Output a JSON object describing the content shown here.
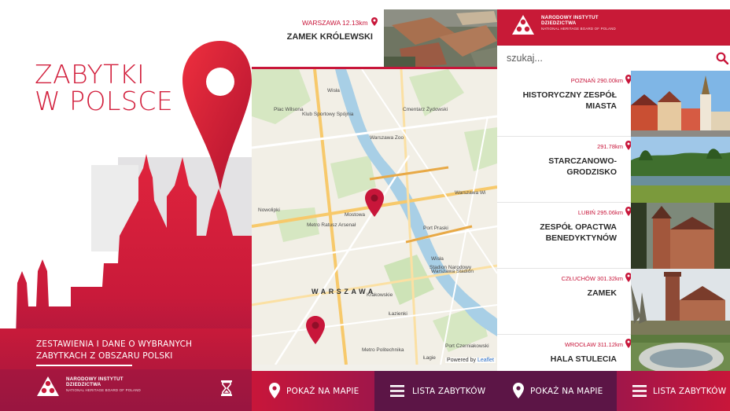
{
  "splash": {
    "title_line1": "ZABYTKI",
    "title_line2": "W POLSCE",
    "subtitle_line1": "ZESTAWIENIA I DANE O WYBRANYCH",
    "subtitle_line2": "ZABYTKACH Z OBSZARU POLSKI",
    "logo_line1": "NARODOWY INSTYTUT",
    "logo_line2": "DZIEDZICTWA",
    "logo_line3": "NATIONAL HERITAGE BOARD OF POLAND",
    "loading_icon": "hourglass-icon"
  },
  "map_screen": {
    "selected": {
      "distance": "WARSZAWA 12.13km",
      "name": "ZAMEK KRÓLEWSKI"
    },
    "city_label": "WARSZAWA",
    "attribution_prefix": "Powered by",
    "attribution_link": "Leaflet",
    "labels": [
      "Wisła",
      "Plac Wilsona",
      "Klub Sportowy Spójnia",
      "Cmentarz Żydowski",
      "Warszawa Zoo",
      "Warszawa Wi",
      "Mostowa",
      "Metro Ratusz Arsenał",
      "Port Praski",
      "Stadion Narodowy",
      "Metro Politechnika",
      "Port Czerniakowski",
      "Łazienki",
      "Wisła",
      "Nowolipki",
      "Krakowskie",
      "Warszawa Stadion",
      "Łagie"
    ]
  },
  "list_screen": {
    "logo_line1": "NARODOWY INSTYTUT",
    "logo_line2": "DZIEDZICTWA",
    "logo_line3": "NATIONAL HERITAGE BOARD OF POLAND",
    "search_placeholder": "szukaj...",
    "items": [
      {
        "distance": "POZNAŃ 290.00km",
        "name": "HISTORYCZNY ZESPÓŁ MIASTA"
      },
      {
        "distance": "291.78km",
        "name": "STARCZANOWO-GRODZISKO"
      },
      {
        "distance": "LUBIŃ 295.06km",
        "name": "ZESPÓŁ OPACTWA BENEDYKTYNÓW"
      },
      {
        "distance": "CZŁUCHÓW 301.32km",
        "name": "ZAMEK"
      },
      {
        "distance": "WROCŁAW 311.12km",
        "name": "HALA STULECIA"
      }
    ]
  },
  "nav": {
    "map_label": "POKAŻ NA MAPIE",
    "list_label": "LISTA ZABYTKÓW"
  },
  "colors": {
    "brand_red": "#c8163a",
    "nav_red": "#a8163a",
    "nav_purple": "#5c1546",
    "map_background": "#f2f0ea"
  }
}
